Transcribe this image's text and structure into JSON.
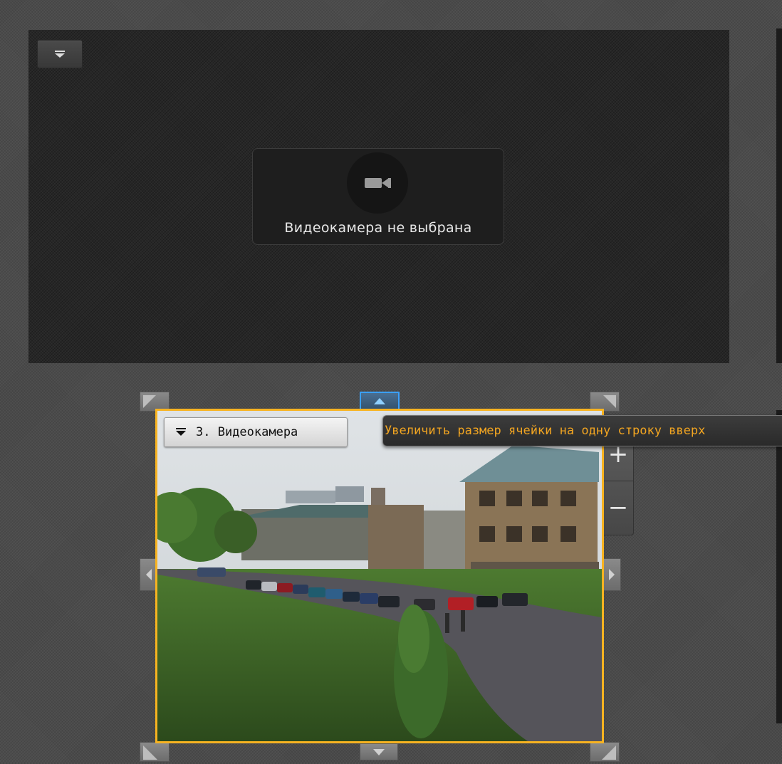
{
  "empty_cell": {
    "menu_icon": "dropdown-menu-icon",
    "placeholder_icon": "video-camera-icon",
    "message": "Видеокамера не выбрана"
  },
  "camera_cell": {
    "label_icon": "dropdown-menu-icon",
    "label": "3. Видеокамера",
    "accent_color": "#f7b321"
  },
  "zoom": {
    "plus_label": "+",
    "minus_label": "−"
  },
  "tooltip": {
    "text": "Увеличить размер ячейки на одну строку вверх",
    "color": "#f2a521"
  },
  "resize_handles": [
    "top-left-resize-icon",
    "top-expand-icon",
    "top-right-resize-icon",
    "left-expand-icon",
    "right-expand-icon",
    "bottom-left-resize-icon",
    "bottom-expand-icon",
    "bottom-right-resize-icon"
  ]
}
